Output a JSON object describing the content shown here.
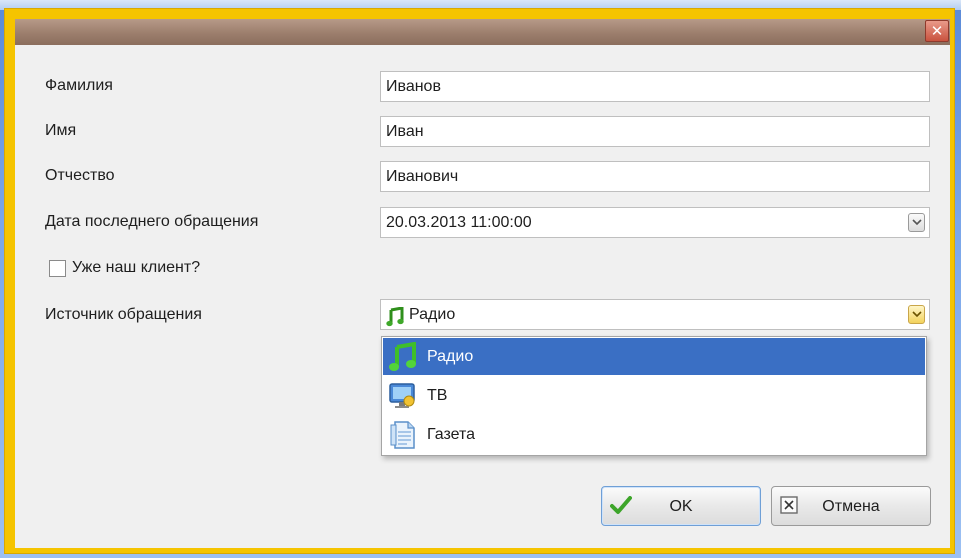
{
  "dialog": {
    "close_glyph": "✕"
  },
  "form": {
    "last_name": {
      "label": "Фамилия",
      "value": "Иванов"
    },
    "first_name": {
      "label": "Имя",
      "value": "Иван"
    },
    "patronymic": {
      "label": "Отчество",
      "value": "Иванович"
    },
    "last_contact_date": {
      "label": "Дата последнего обращения",
      "value": "20.03.2013 11:00:00"
    },
    "existing_client": {
      "label": "Уже наш клиент?",
      "checked": false
    },
    "source": {
      "label": "Источник обращения",
      "value": "Радио",
      "value_icon": "music-note-icon",
      "options": [
        {
          "label": "Радио",
          "icon": "music-note-icon",
          "selected": true
        },
        {
          "label": "ТВ",
          "icon": "tv-icon",
          "selected": false
        },
        {
          "label": "Газета",
          "icon": "newspaper-icon",
          "selected": false
        }
      ]
    }
  },
  "buttons": {
    "ok": {
      "label": "OK",
      "icon": "checkmark-icon"
    },
    "cancel": {
      "label": "Отмена",
      "icon": "close-box-icon"
    }
  },
  "colors": {
    "frame": "#f5c400",
    "titlebar": "#9c7e6d",
    "selection": "#3a6fc4",
    "close_button": "#c9523e"
  }
}
